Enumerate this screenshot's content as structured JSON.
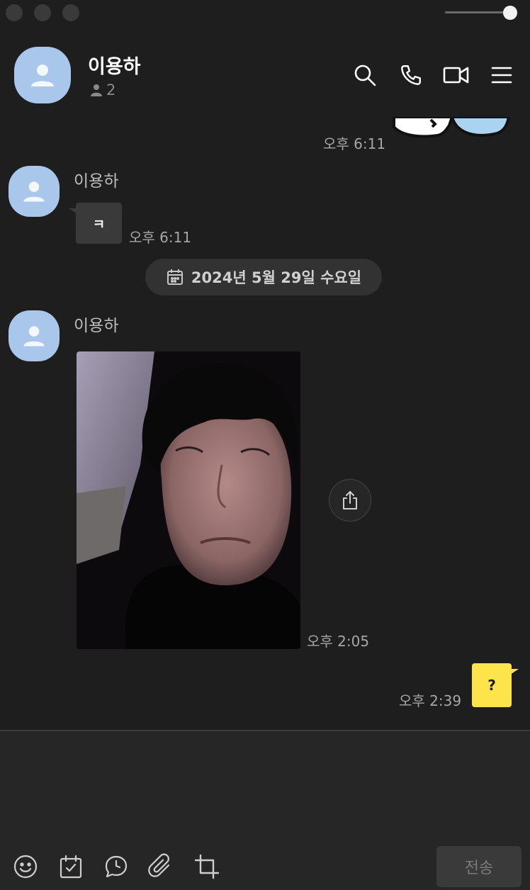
{
  "header": {
    "title": "이용하",
    "member_count": "2",
    "icons": [
      "search-icon",
      "phone-icon",
      "video-call-icon",
      "menu-icon"
    ]
  },
  "messages": {
    "sticker_time": "오후 6:11",
    "msg1": {
      "sender": "이용하",
      "text": "ㅋ",
      "time": "오후 6:11"
    },
    "date_divider": "2024년 5월 29일 수요일",
    "msg2": {
      "sender": "이용하",
      "time": "오후 2:05"
    },
    "msg3": {
      "text": "?",
      "time": "오후 2:39"
    }
  },
  "input": {
    "placeholder": "",
    "send_label": "전송",
    "tools": [
      "emoticon-icon",
      "calendar-check-icon",
      "chat-bubble-clock-icon",
      "paperclip-icon",
      "crop-icon"
    ]
  },
  "colors": {
    "background": "#1e1e1e",
    "my_bubble": "#fee44b",
    "their_bubble": "#3a3a3a",
    "avatar": "#a9c7ea"
  }
}
